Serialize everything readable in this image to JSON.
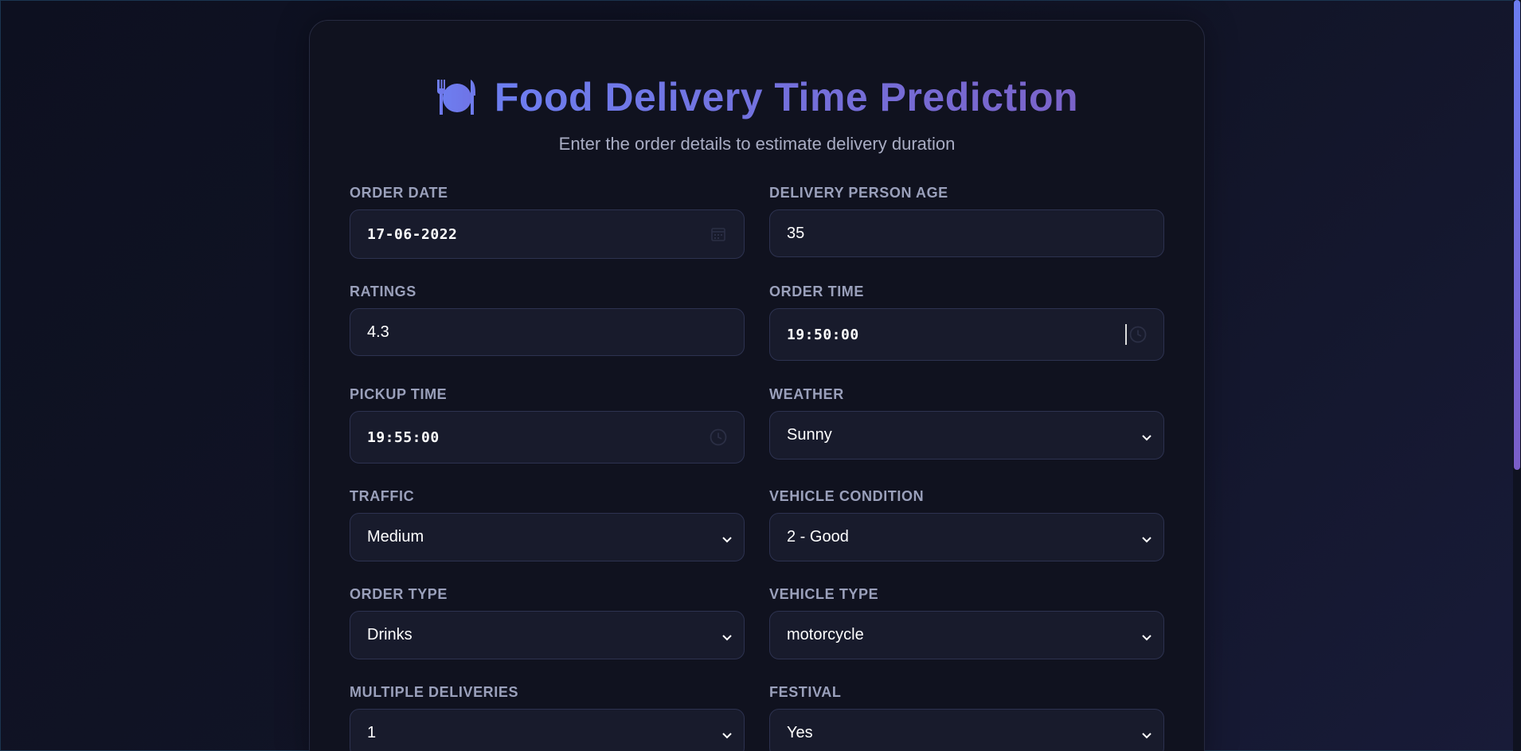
{
  "header": {
    "title": "Food Delivery Time Prediction",
    "subtitle": "Enter the order details to estimate delivery duration",
    "icon": "plate-utensils-icon"
  },
  "form": {
    "order_date": {
      "label": "ORDER DATE",
      "value": "17-06-2022",
      "icon": "calendar-icon"
    },
    "delivery_person_age": {
      "label": "DELIVERY PERSON AGE",
      "value": "35"
    },
    "ratings": {
      "label": "RATINGS",
      "value": "4.3"
    },
    "order_time": {
      "label": "ORDER TIME",
      "value": "19:50:00",
      "icon": "clock-icon"
    },
    "pickup_time": {
      "label": "PICKUP TIME",
      "value": "19:55:00",
      "icon": "clock-icon"
    },
    "weather": {
      "label": "WEATHER",
      "value": "Sunny"
    },
    "traffic": {
      "label": "TRAFFIC",
      "value": "Medium"
    },
    "vehicle_condition": {
      "label": "VEHICLE CONDITION",
      "value": "2 - Good"
    },
    "order_type": {
      "label": "ORDER TYPE",
      "value": "Drinks"
    },
    "vehicle_type": {
      "label": "VEHICLE TYPE",
      "value": "motorcycle"
    },
    "multiple_deliveries": {
      "label": "MULTIPLE DELIVERIES",
      "value": "1"
    },
    "festival": {
      "label": "FESTIVAL",
      "value": "Yes"
    }
  },
  "colors": {
    "accent_start": "#6d7ef0",
    "accent_end": "#7a63c9",
    "background": "#0d1020",
    "card": "#10121f",
    "input": "#181b2c"
  }
}
